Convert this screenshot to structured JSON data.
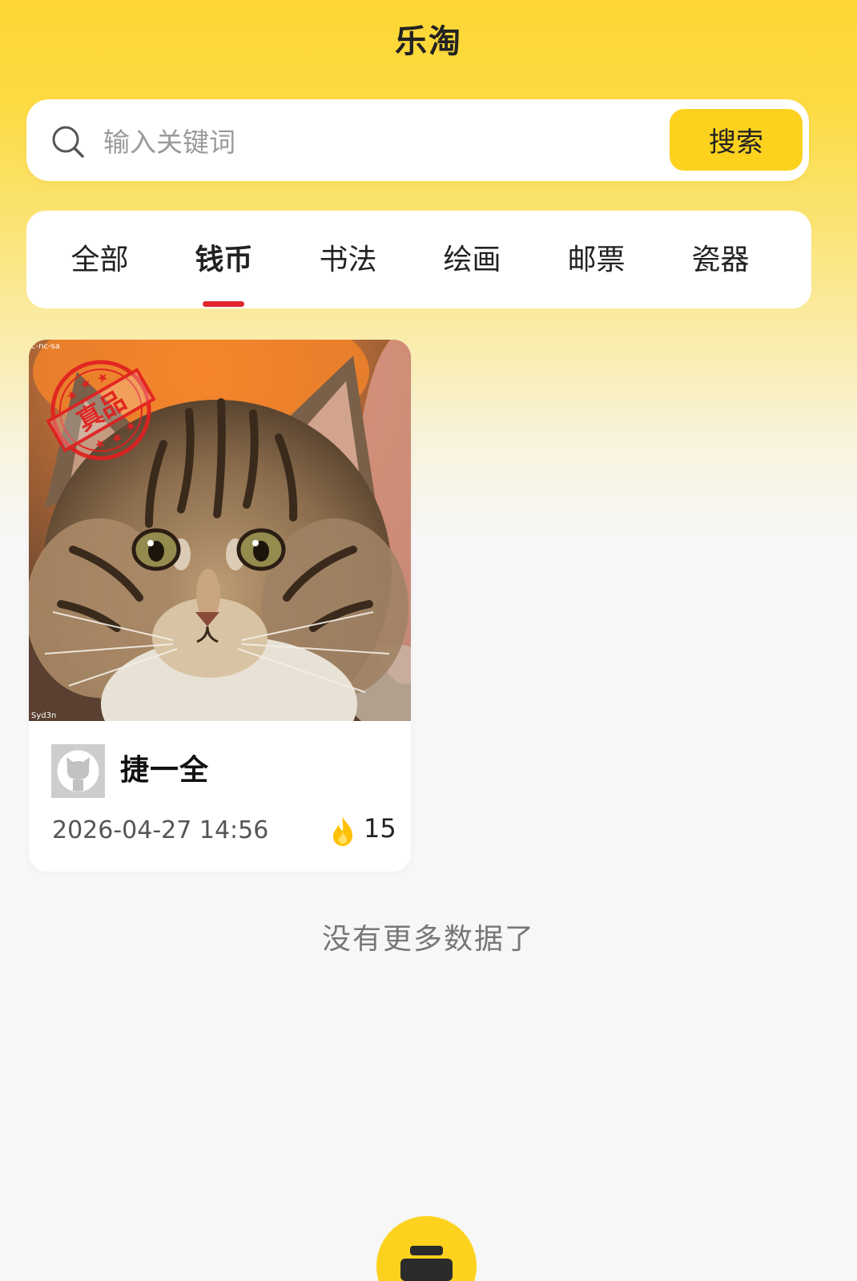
{
  "app": {
    "title": "乐淘"
  },
  "search": {
    "placeholder": "输入关键词",
    "value": "",
    "button_label": "搜索",
    "icon": "search-icon"
  },
  "tabs": [
    {
      "label": "全部",
      "active": false
    },
    {
      "label": "钱币",
      "active": true
    },
    {
      "label": "书法",
      "active": false
    },
    {
      "label": "绘画",
      "active": false
    },
    {
      "label": "邮票",
      "active": false
    },
    {
      "label": "瓷器",
      "active": false
    }
  ],
  "products": [
    {
      "author": "捷一全",
      "time": "2026-04-27 14:56",
      "heat": "15",
      "heat_icon": "fire-icon",
      "avatar_icon": "github-octocat-icon",
      "stamp_text": "真品",
      "watermark_top": "c-nc-sa",
      "watermark_bottom": "Syd3n"
    }
  ],
  "list_end_text": "没有更多数据了",
  "fab": {
    "icon": "bag-icon"
  },
  "colors": {
    "accent": "#FDD21F",
    "tab_indicator": "#E0262E",
    "page_background": "#F7F7F7"
  }
}
